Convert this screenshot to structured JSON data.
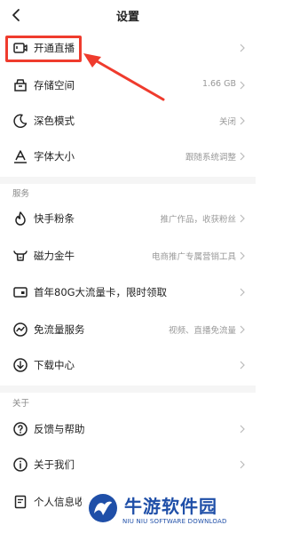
{
  "header": {
    "title": "设置"
  },
  "rows": {
    "live": {
      "label": "开通直播",
      "value": ""
    },
    "storage": {
      "label": "存储空间",
      "value": "1.66 GB"
    },
    "dark": {
      "label": "深色模式",
      "value": "关闭"
    },
    "font": {
      "label": "字体大小",
      "value": "跟随系统调整"
    },
    "fans": {
      "label": "快手粉条",
      "value": "推广作品，收获粉丝"
    },
    "jinniu": {
      "label": "磁力金牛",
      "value": "电商推广专属营销工具"
    },
    "card": {
      "label": "首年80G大流量卡，限时领取",
      "value": ""
    },
    "freeflow": {
      "label": "免流量服务",
      "value": "视频、直播免流量"
    },
    "download": {
      "label": "下载中心",
      "value": ""
    },
    "feedback": {
      "label": "反馈与帮助",
      "value": ""
    },
    "about": {
      "label": "关于我们",
      "value": ""
    },
    "personal": {
      "label": "个人信息收",
      "value": ""
    }
  },
  "sections": {
    "service": "服务",
    "about": "关于"
  },
  "annotation": {
    "highlight_color": "#ef3b2d"
  },
  "watermark": {
    "cn": "牛游软件园",
    "en": "NIU NIU SOFTWARE DOWNLOAD"
  }
}
